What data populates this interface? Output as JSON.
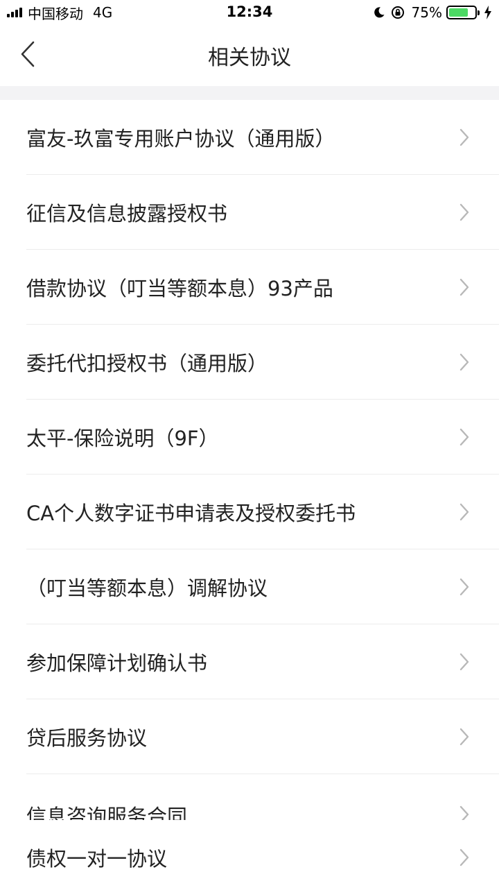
{
  "status_bar": {
    "carrier": "中国移动",
    "network": "4G",
    "time": "12:34",
    "battery": "75%",
    "battery_level": 0.75
  },
  "nav": {
    "title": "相关协议",
    "back_icon": "chevron-left-icon"
  },
  "agreements": [
    "富友-玖富专用账户协议（通用版）",
    "征信及信息披露授权书",
    "借款协议（叮当等额本息）93产品",
    "委托代扣授权书（通用版）",
    "太平-保险说明（9F）",
    "CA个人数字证书申请表及授权委托书",
    "（叮当等额本息）调解协议",
    "参加保障计划确认书",
    "贷后服务协议",
    "信息咨询服务合同",
    "债权一对一协议"
  ],
  "colors": {
    "battery_green": "#4cd964",
    "separator": "#ececec",
    "section_gap": "#f3f3f5",
    "chevron": "#b8b8b8"
  }
}
